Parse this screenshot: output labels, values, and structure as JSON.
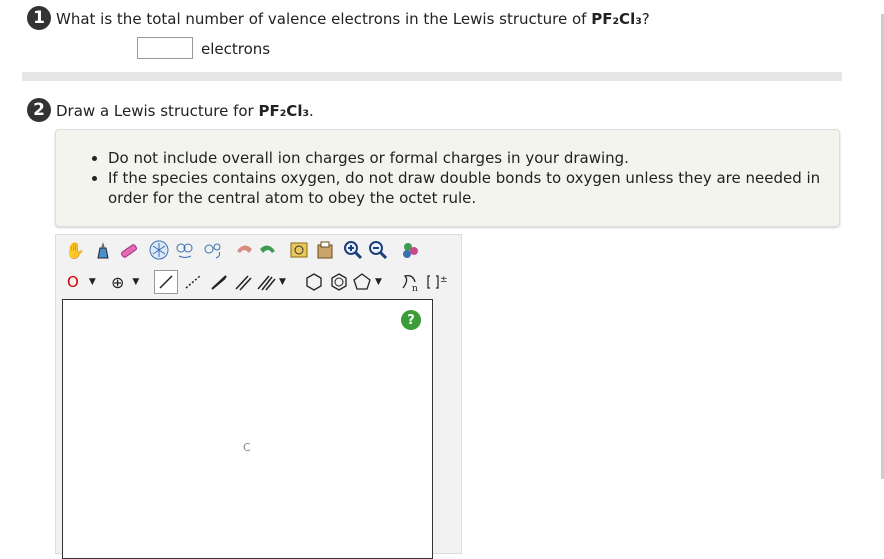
{
  "question1": {
    "number": "1",
    "text": "What is the total number of valence electrons in the Lewis structure of",
    "formula_html": "PF₂Cl₃",
    "formula_suffix": "?",
    "answer_value": "",
    "unit_label": "electrons"
  },
  "question2": {
    "number": "2",
    "text": "Draw a Lewis structure for",
    "formula_html": "PF₂Cl₃",
    "formula_suffix": ".",
    "notes": [
      "Do not include overall ion charges or formal charges in your drawing.",
      "If the species contains oxygen, do not draw double bonds to oxygen unless they are needed in order for the central atom to obey the octet rule."
    ]
  },
  "editor": {
    "atom_selector": "O",
    "charge_selector": "⊕",
    "help_label": "?",
    "canvas_atom": "C",
    "toolbar_row1_icons": [
      "hand-icon",
      "clean-icon",
      "eraser-icon",
      "template-icon",
      "rotate-icon",
      "flip-icon",
      "undo-icon",
      "redo-icon",
      "import-icon",
      "export-icon",
      "zoom-in-icon",
      "zoom-out-icon",
      "color-icon"
    ],
    "toolbar_row2_icons": [
      "single-bond-icon",
      "dashed-bond-icon",
      "wedge-bond-icon",
      "double-bond-icon",
      "triple-bond-icon",
      "cyclohexane-icon",
      "benzene-icon",
      "pentagon-icon",
      "sgroup-icon",
      "bracket-icon"
    ]
  },
  "colors": {
    "accent_green": "#3a9d3a",
    "atom_red": "#d00000"
  }
}
